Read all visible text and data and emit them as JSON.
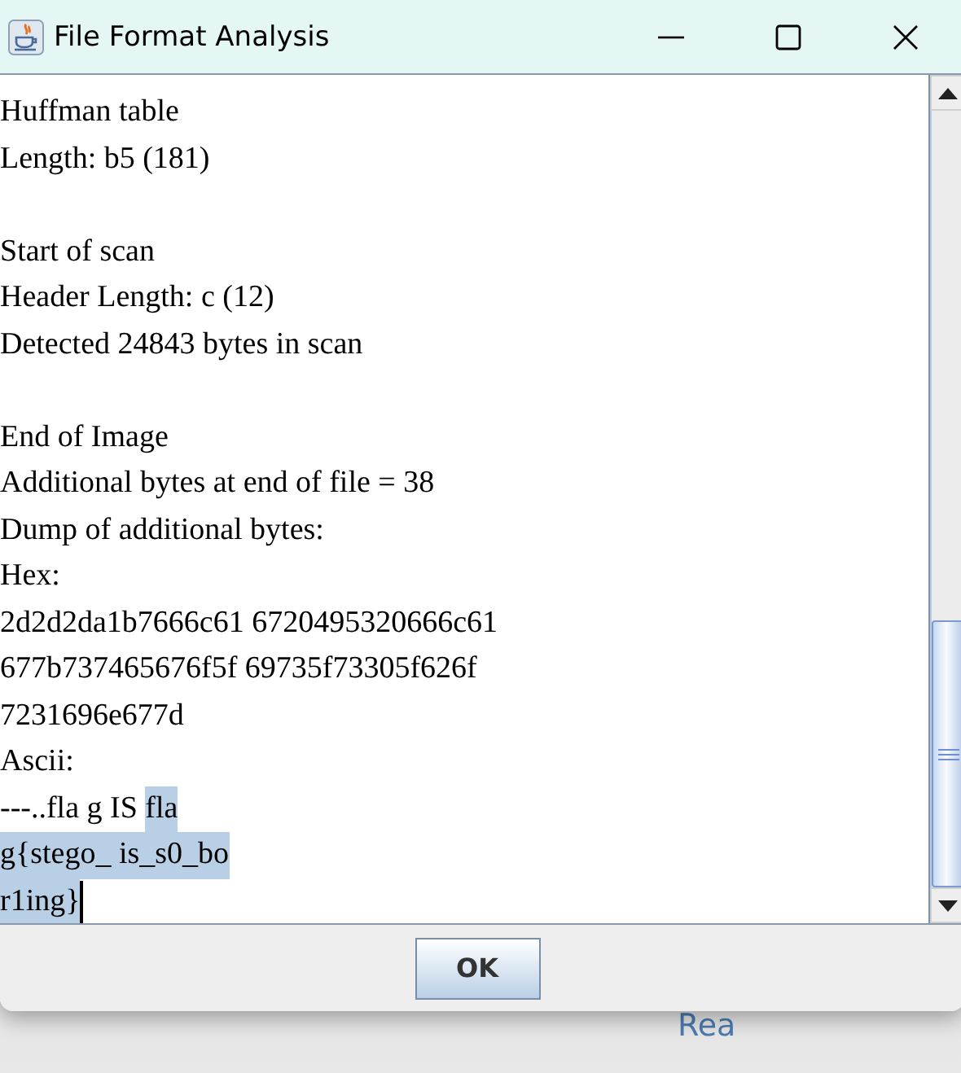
{
  "window": {
    "title": "File Format Analysis"
  },
  "output": {
    "lines": [
      [
        {
          "text": "Huffman table",
          "selected": false
        }
      ],
      [
        {
          "text": "Length: b5 (181)",
          "selected": false
        }
      ],
      {
        "kind": "blank"
      },
      [
        {
          "text": "Start of scan",
          "selected": false
        }
      ],
      [
        {
          "text": "Header Length: c (12)",
          "selected": false
        }
      ],
      [
        {
          "text": "Detected 24843 bytes in scan",
          "selected": false
        }
      ],
      {
        "kind": "blank"
      },
      [
        {
          "text": "End of Image",
          "selected": false
        }
      ],
      [
        {
          "text": "Additional bytes at end of file = 38",
          "selected": false
        }
      ],
      [
        {
          "text": "Dump of additional bytes:",
          "selected": false
        }
      ],
      [
        {
          "text": "Hex:",
          "selected": false
        }
      ],
      [
        {
          "text": "2d2d2da1b7666c61 6720495320666c61",
          "selected": false
        }
      ],
      [
        {
          "text": "677b737465676f5f 69735f73305f626f",
          "selected": false
        }
      ],
      [
        {
          "text": "7231696e677d",
          "selected": false
        }
      ],
      [
        {
          "text": "Ascii:",
          "selected": false
        }
      ],
      [
        {
          "text": "---..fla g IS ",
          "selected": false
        },
        {
          "text": "fla",
          "selected": true
        }
      ],
      [
        {
          "text": "g{stego_ is_s0_bo",
          "selected": true
        }
      ],
      [
        {
          "text": "r1ing}",
          "selected": true
        }
      ]
    ],
    "caret": true
  },
  "buttons": [
    "OK"
  ],
  "background_text": "Rea"
}
